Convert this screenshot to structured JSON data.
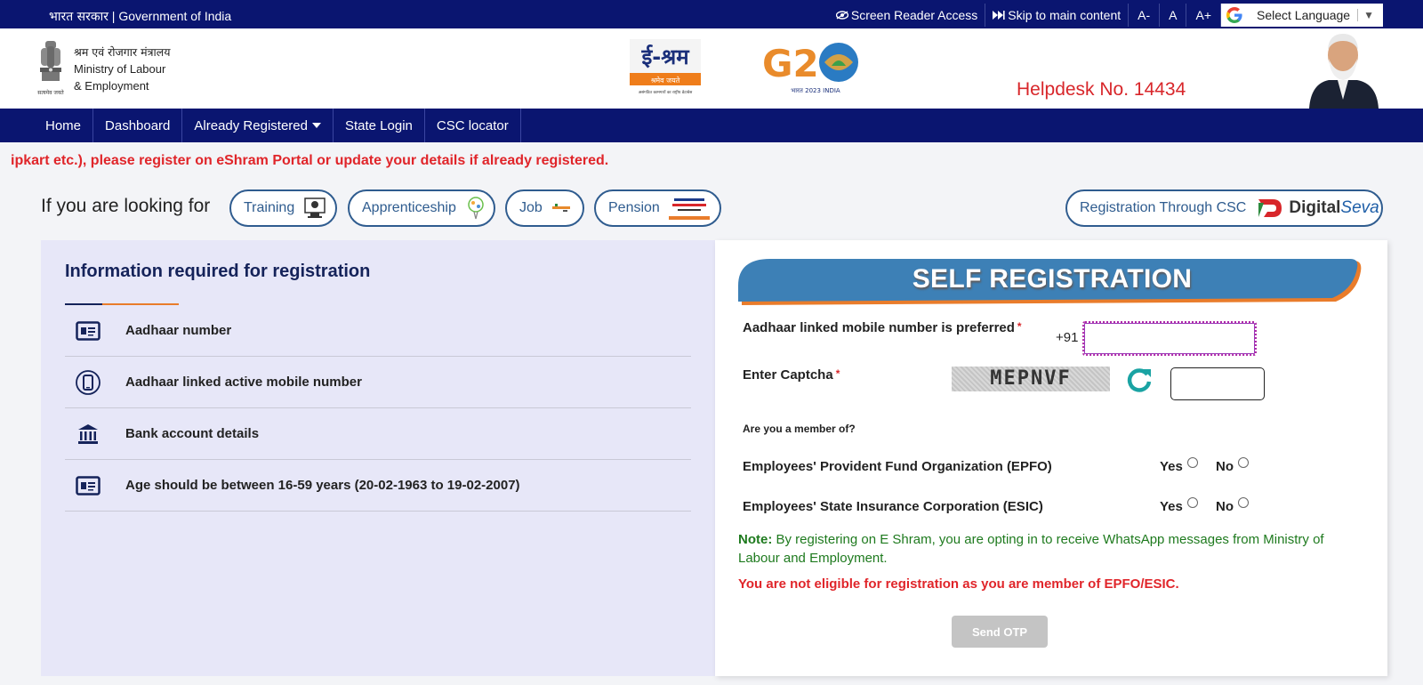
{
  "topbar": {
    "gov_hindi": "भारत सरकार",
    "gov_separator": " | ",
    "gov_english": "Government of India",
    "screen_reader": "Screen Reader Access",
    "skip": "Skip to main content",
    "font_small": "A-",
    "font_normal": "A",
    "font_large": "A+",
    "language": "Select Language",
    "language_arrow": "▼"
  },
  "header": {
    "ministry_hindi": "श्रम एवं रोजगार मंत्रालय",
    "ministry_line1": "Ministry of Labour",
    "ministry_line2": "& Employment",
    "emblem_motto": "सत्यमेव जयते",
    "eshram_logo_text": "ई-श्रम",
    "eshram_tagline": "श्रमेव जयते",
    "eshram_subtitle": "असंगठित कामगारों का राष्ट्रीय डेटाबेस",
    "g20_text": "G20",
    "g20_subtitle": "भारत 2023 INDIA",
    "helpdesk": "Helpdesk No. 14434"
  },
  "nav": {
    "items": [
      "Home",
      "Dashboard",
      "Already Registered",
      "State Login",
      "CSC locator"
    ]
  },
  "marquee": "ipkart etc.), please register on eShram Portal or update your details if already registered.",
  "looking": {
    "label": "If you are looking for",
    "pills": [
      "Training",
      "Apprenticeship",
      "Job",
      "Pension"
    ],
    "csc": "Registration Through CSC",
    "digital_brand": "Digital",
    "digital_brand_2": "Seva"
  },
  "info": {
    "title": "Information required for registration",
    "items": [
      "Aadhaar number",
      "Aadhaar linked active mobile number",
      "Bank account details",
      "Age should be between 16-59 years (20-02-1963 to 19-02-2007)"
    ]
  },
  "form": {
    "title": "SELF REGISTRATION",
    "mobile_label": "Aadhaar linked mobile number is preferred",
    "required_mark": "*",
    "mobile_prefix": "+91",
    "mobile_value": "",
    "captcha_label": "Enter Captcha",
    "captcha_text": "MEPNVF",
    "captcha_value": "",
    "member_question": "Are you a member of?",
    "epfo_label": "Employees' Provident Fund Organization (EPFO)",
    "esic_label": "Employees' State Insurance Corporation (ESIC)",
    "yes": "Yes",
    "no": "No",
    "note_label": "Note:",
    "note_text": " By registering on E Shram, you are opting in to receive WhatsApp messages from Ministry of Labour and Employment.",
    "error": "You are not eligible for registration as you are member of EPFO/ESIC.",
    "send_otp": "Send OTP"
  },
  "colors": {
    "navy": "#0a1570",
    "helpdesk_red": "#d8262a",
    "pill_blue": "#2f5c8f",
    "banner_blue": "#3d80b6",
    "banner_orange": "#e97c2b",
    "note_green": "#1e7a1e",
    "left_panel": "#e7e7f8"
  },
  "icons": [
    "eye-icon",
    "skip-icon",
    "google-icon",
    "emblem-icon",
    "id-card-icon",
    "mobile-icon",
    "bank-icon",
    "refresh-icon"
  ]
}
